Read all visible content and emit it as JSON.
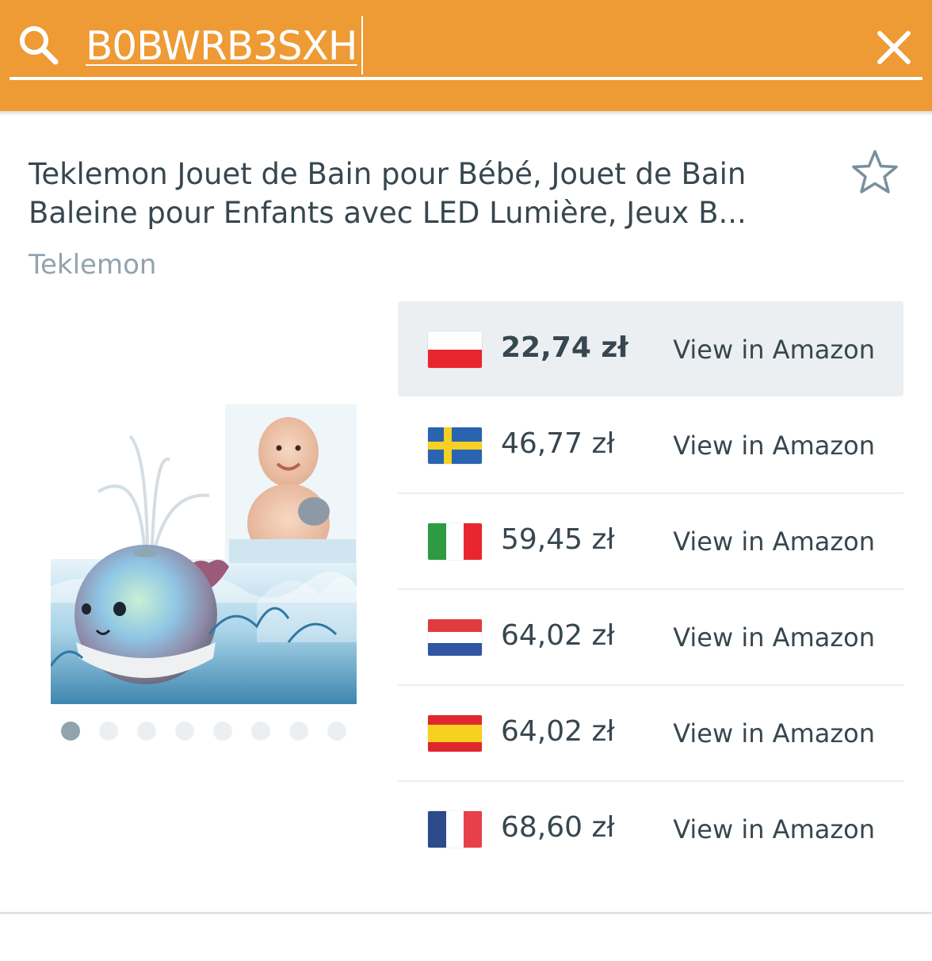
{
  "search": {
    "value": "B0BWRB3SXH",
    "placeholder": ""
  },
  "product": {
    "title": "Teklemon Jouet de Bain pour Bébé, Jouet de Bain Baleine pour Enfants avec LED Lumière, Jeux B...",
    "brand": "Teklemon",
    "image_count": 8,
    "active_image_index": 0
  },
  "prices": [
    {
      "country": "Poland",
      "flag": "pl-flag-icon",
      "price": "22,74 zł",
      "link": "View in Amazon",
      "selected": true
    },
    {
      "country": "Sweden",
      "flag": "se-flag-icon",
      "price": "46,77 zł",
      "link": "View in Amazon",
      "selected": false
    },
    {
      "country": "Italy",
      "flag": "it-flag-icon",
      "price": "59,45 zł",
      "link": "View in Amazon",
      "selected": false
    },
    {
      "country": "Netherlands",
      "flag": "nl-flag-icon",
      "price": "64,02 zł",
      "link": "View in Amazon",
      "selected": false
    },
    {
      "country": "Spain",
      "flag": "es-flag-icon",
      "price": "64,02 zł",
      "link": "View in Amazon",
      "selected": false
    },
    {
      "country": "France",
      "flag": "fr-flag-icon",
      "price": "68,60 zł",
      "link": "View in Amazon",
      "selected": false
    }
  ],
  "colors": {
    "header": "#ee9a35",
    "text": "#37474f",
    "muted": "#90a4ae",
    "selected_row": "#eceff1"
  }
}
